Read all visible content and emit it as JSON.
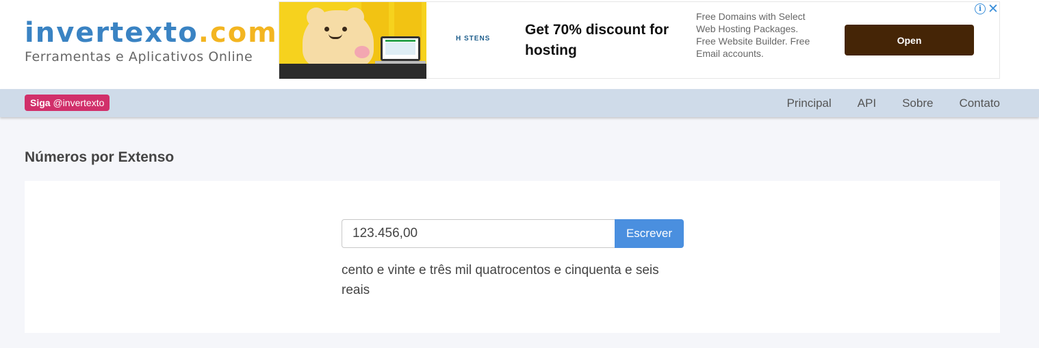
{
  "header": {
    "logo_name": "invertexto",
    "logo_tld": ".com",
    "tagline": "Ferramentas e Aplicativos Online"
  },
  "ad": {
    "brand": "H STENS",
    "headline": "Get 70% discount for hosting",
    "description": "Free Domains with Select Web Hosting Packages. Free Website Builder. Free Email accounts.",
    "open_label": "Open",
    "info_glyph": "i",
    "close_glyph": "✕"
  },
  "nav": {
    "follow_strong": "Siga",
    "follow_handle": "@invertexto",
    "links": [
      "Principal",
      "API",
      "Sobre",
      "Contato"
    ]
  },
  "main": {
    "title": "Números por Extenso",
    "input_value": "123.456,00",
    "button_label": "Escrever",
    "result": "cento e vinte e três mil quatrocentos e cinquenta e seis reais"
  },
  "colors": {
    "logo_blue": "#3a83c3",
    "logo_yellow": "#f3b521",
    "navbar_bg": "#cfdbe9",
    "follow_badge": "#d1306a",
    "primary_button": "#4a8fdf",
    "ad_button": "#452506"
  }
}
